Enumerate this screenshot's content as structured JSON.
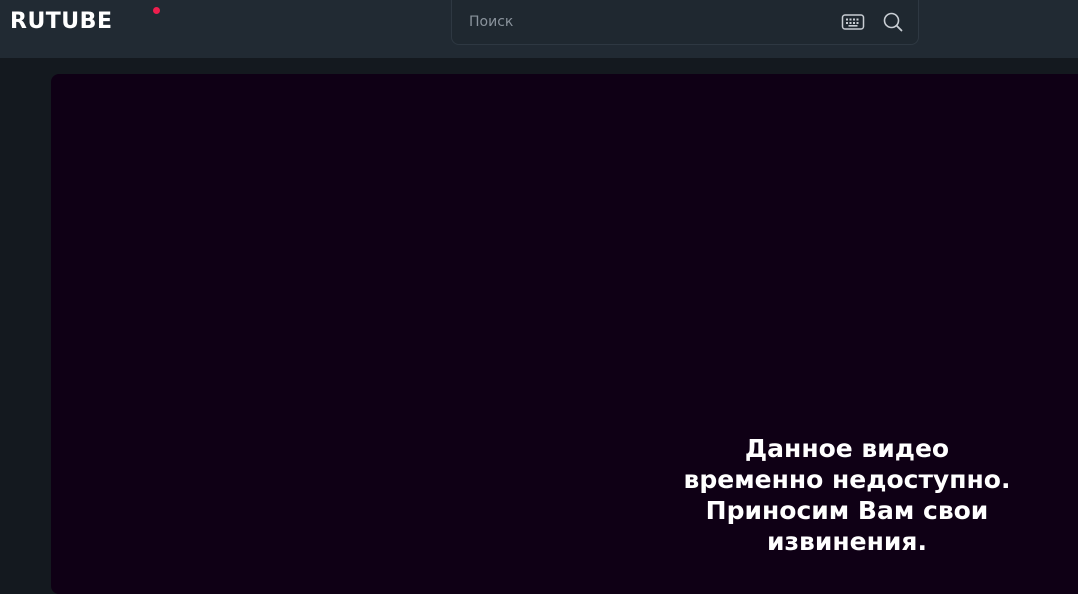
{
  "header": {
    "logo_text": "RUTUBE",
    "logo_dot_color": "#ee1e4e",
    "background": "#212a33"
  },
  "search": {
    "placeholder": "Поиск",
    "value": "",
    "keyboard_icon": "keyboard-icon",
    "search_icon": "search-icon"
  },
  "player": {
    "background": "#0f0015",
    "message": "Данное видео временно недоступно. Приносим Вам свои извинения."
  }
}
